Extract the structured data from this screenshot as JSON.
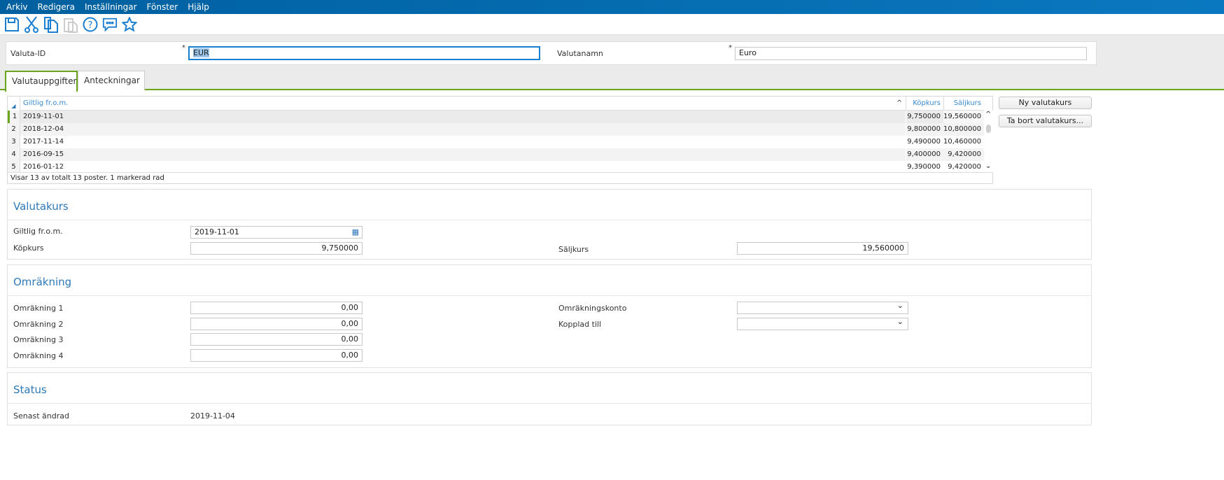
{
  "menu": [
    "Arkiv",
    "Redigera",
    "Inställningar",
    "Fönster",
    "Hjälp"
  ],
  "toolbar_icons": [
    "save-icon",
    "cut-icon",
    "copy-icon",
    "paste-icon",
    "help-icon",
    "comment-icon",
    "star-icon"
  ],
  "header": {
    "id_label": "Valuta-ID",
    "id_value": "EUR",
    "name_label": "Valutanamn",
    "name_value": "Euro",
    "required": "*"
  },
  "tabs": [
    "Valutauppgifter",
    "Anteckningar"
  ],
  "grid": {
    "columns": [
      "Giltlig fr.o.m.",
      "Köpkurs",
      "Säljkurs"
    ],
    "rows": [
      {
        "n": "1",
        "date": "2019-11-01",
        "kop": "9,750000",
        "salj": "19,560000"
      },
      {
        "n": "2",
        "date": "2018-12-04",
        "kop": "9,800000",
        "salj": "10,800000"
      },
      {
        "n": "3",
        "date": "2017-11-14",
        "kop": "9,490000",
        "salj": "10,460000"
      },
      {
        "n": "4",
        "date": "2016-09-15",
        "kop": "9,400000",
        "salj": "9,420000"
      },
      {
        "n": "5",
        "date": "2016-01-12",
        "kop": "9,390000",
        "salj": "9,420000"
      }
    ],
    "footer": "Visar 13 av totalt 13 poster. 1 markerad rad"
  },
  "buttons": {
    "new": "Ny valutakurs",
    "delete": "Ta bort valutakurs..."
  },
  "valutakurs": {
    "title": "Valutakurs",
    "date_label": "Giltlig fr.o.m.",
    "date_value": "2019-11-01",
    "kop_label": "Köpkurs",
    "kop_value": "9,750000",
    "salj_label": "Säljkurs",
    "salj_value": "19,560000"
  },
  "omrakning": {
    "title": "Omräkning",
    "rows": [
      {
        "label": "Omräkning 1",
        "value": "0,00"
      },
      {
        "label": "Omräkning 2",
        "value": "0,00"
      },
      {
        "label": "Omräkning 3",
        "value": "0,00"
      },
      {
        "label": "Omräkning 4",
        "value": "0,00"
      }
    ],
    "konto_label": "Omräkningskonto",
    "konto_value": "",
    "kopplad_label": "Kopplad till",
    "kopplad_value": ""
  },
  "status": {
    "title": "Status",
    "changed_label": "Senast ändrad",
    "changed_value": "2019-11-04"
  },
  "colors": {
    "menubar": "#0068a8",
    "accent": "#6aa51a",
    "link": "#2e79b9"
  }
}
